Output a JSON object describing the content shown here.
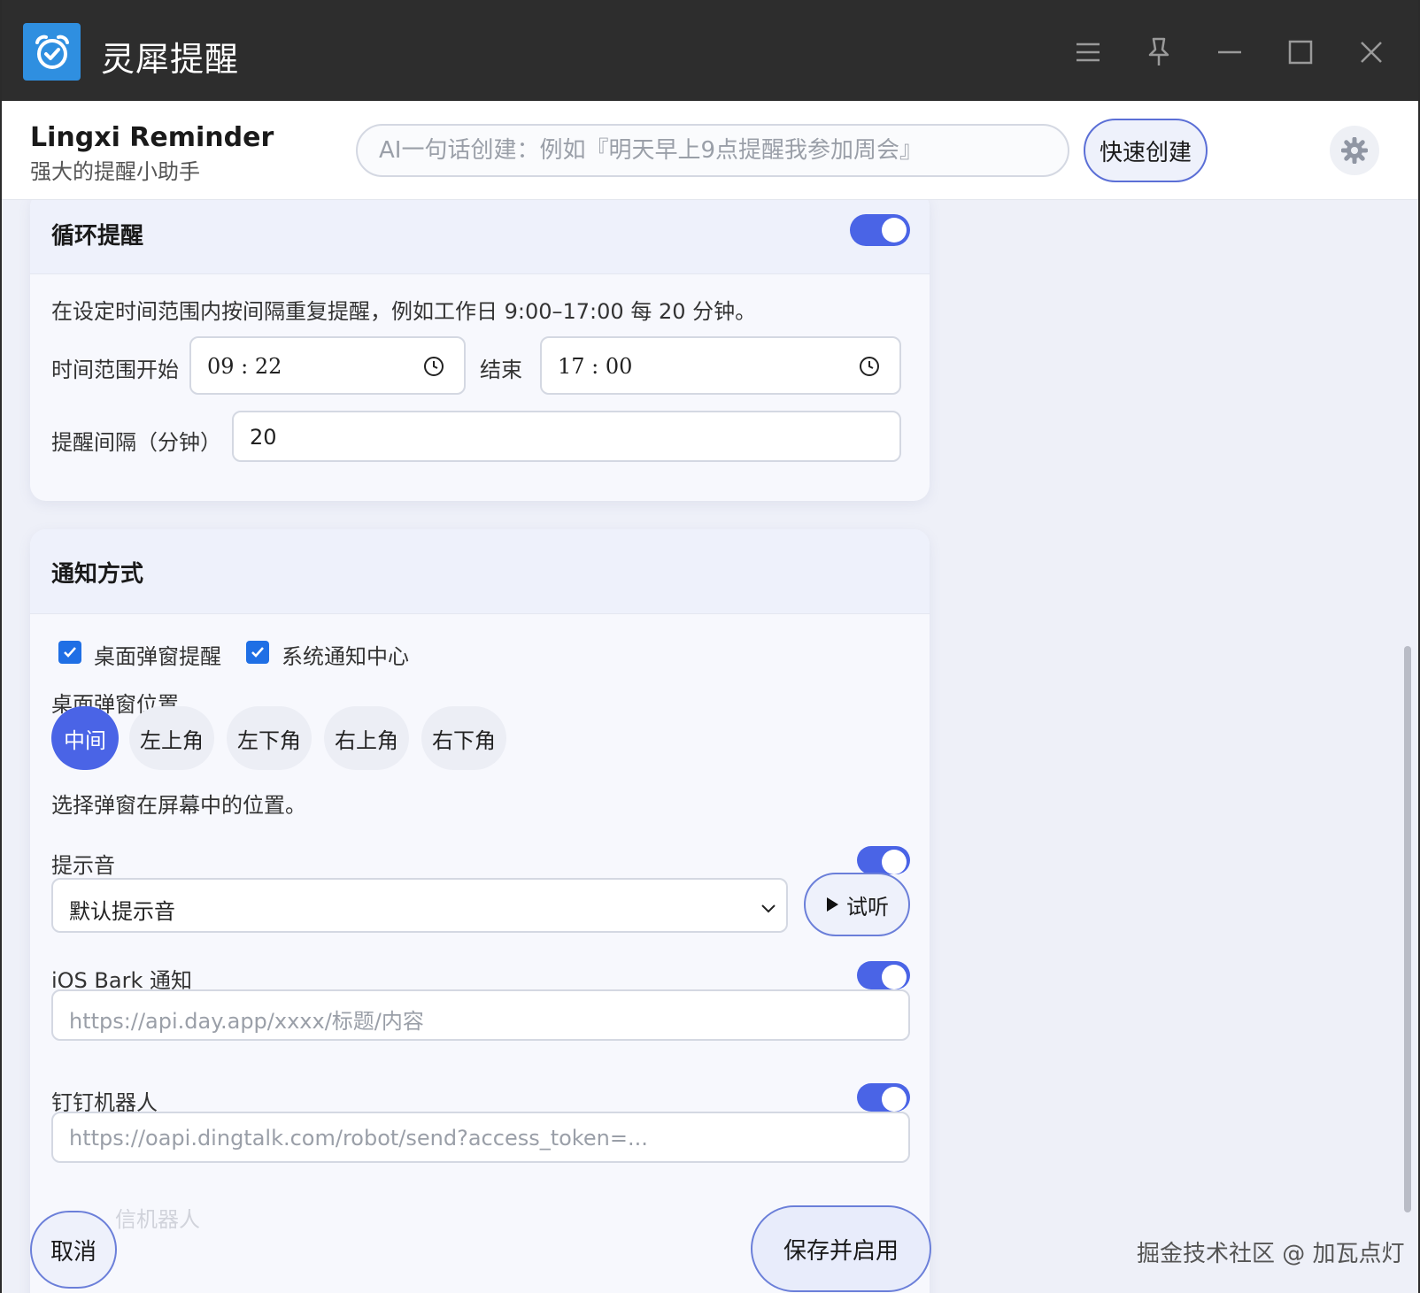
{
  "titlebar": {
    "title": "灵犀提醒",
    "icons": [
      "alarm-clock-logo-icon",
      "menu-icon",
      "pin-icon",
      "minimize-icon",
      "maximize-icon",
      "close-icon"
    ]
  },
  "header": {
    "brand_name": "Lingxi Reminder",
    "brand_sub": "强大的提醒小助手",
    "ai_placeholder": "AI一句话创建：例如『明天早上9点提醒我参加周会』",
    "quick_create": "快速创建"
  },
  "loop": {
    "title": "循环提醒",
    "enabled": true,
    "description": "在设定时间范围内按间隔重复提醒，例如工作日 9:00–17:00 每 20 分钟。",
    "start_label": "时间范围开始",
    "start_value": "09 : 22",
    "end_label": "结束",
    "end_value": "17 : 00",
    "interval_label": "提醒间隔（分钟）",
    "interval_value": "20"
  },
  "notify": {
    "title": "通知方式",
    "desktop_popup": "桌面弹窗提醒",
    "system_center": "系统通知中心",
    "position_label": "桌面弹窗位置",
    "positions": [
      "中间",
      "左上角",
      "左下角",
      "右上角",
      "右下角"
    ],
    "selected_position": "中间",
    "position_hint": "选择弹窗在屏幕中的位置。",
    "sound_label": "提示音",
    "sound_value": "默认提示音",
    "listen": "试听",
    "bark_label": "iOS Bark 通知",
    "bark_placeholder": "https://api.day.app/xxxx/标题/内容",
    "dingtalk_label": "钉钉机器人",
    "dingtalk_placeholder": "https://oapi.dingtalk.com/robot/send?access_token=...",
    "partial_label": "信机器人"
  },
  "footer": {
    "cancel": "取消",
    "save": "保存并启用"
  },
  "watermark": "掘金技术社区 @ 加瓦点灯",
  "colors": {
    "accent": "#4a64e6",
    "titlebar": "#2d2d2d",
    "logo": "#2f8fe0",
    "checkbox": "#1f6fe5"
  }
}
